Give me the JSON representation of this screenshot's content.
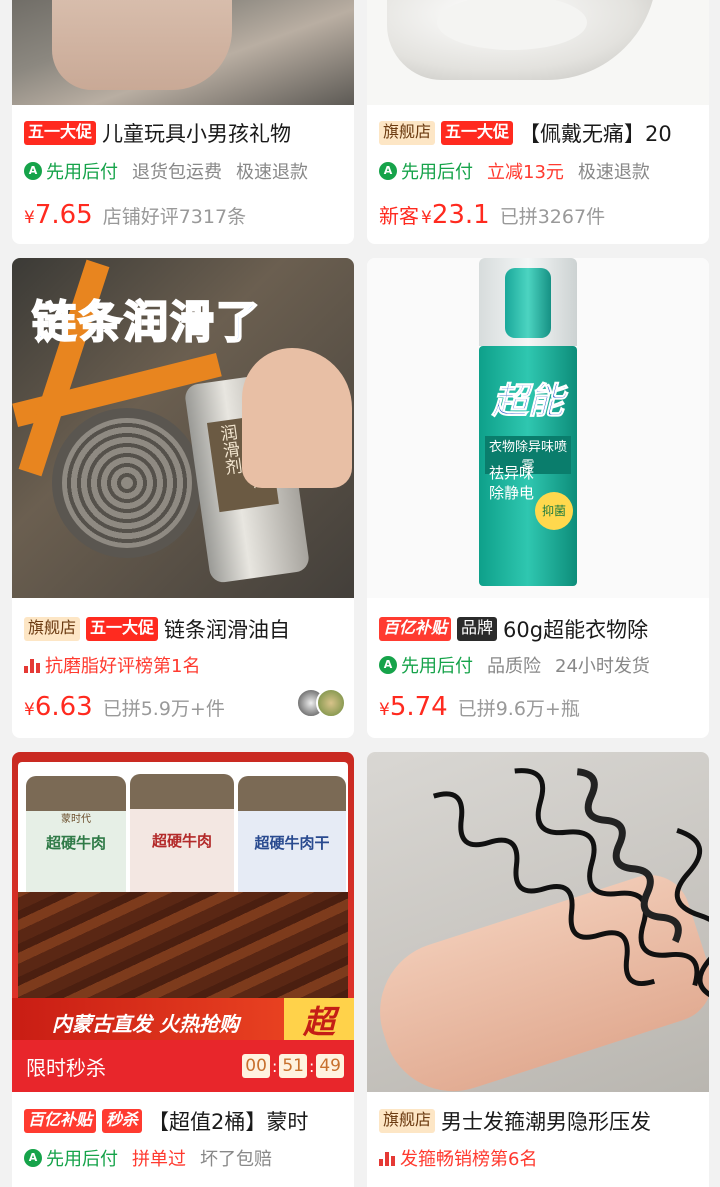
{
  "products": [
    {
      "tags": [
        "五一大促"
      ],
      "title": "儿童玩具小男孩礼物",
      "services": [
        "先用后付",
        "退货包运费",
        "极速退款"
      ],
      "price_currency": "¥",
      "price": "7.65",
      "sales": "店铺好评7317条"
    },
    {
      "tags": [
        "旗舰店",
        "五一大促"
      ],
      "title": "【佩戴无痛】20",
      "services": [
        "先用后付",
        "立减13元",
        "极速退款"
      ],
      "price_prefix": "新客",
      "price_currency": "¥",
      "price": "23.1",
      "sales": "已拼3267件"
    },
    {
      "image_text": "链条润滑了",
      "can_text": "链条专用润滑剂",
      "tags": [
        "旗舰店",
        "五一大促"
      ],
      "title": "链条润滑油自",
      "rank": "抗磨脂好评榜第1名",
      "price_currency": "¥",
      "price": "6.63",
      "sales": "已拼5.9万+件"
    },
    {
      "image_text": "超能",
      "bottle_label": "衣物除异味喷雾",
      "bottle_sub1": "祛异味",
      "bottle_sub2": "除静电",
      "bottle_badge": "抑菌",
      "tags": [
        "百亿补贴",
        "品牌"
      ],
      "title": "60g超能衣物除",
      "services": [
        "先用后付",
        "品质险",
        "24小时发货"
      ],
      "price_currency": "¥",
      "price": "5.74",
      "sales": "已拼9.6万+瓶"
    },
    {
      "jar_label": "超硬牛肉",
      "jar_label3": "超硬牛肉干",
      "jar_brand": "蒙时代",
      "banner_text": "内蒙古直发 火热抢购",
      "banner_badge": "超",
      "flash_label": "限时秒杀",
      "timer": [
        "00",
        "51",
        "49"
      ],
      "tags": [
        "百亿补贴",
        "秒杀"
      ],
      "title": "【超值2桶】蒙时",
      "services": [
        "先用后付",
        "拼单过",
        "坏了包赔"
      ]
    },
    {
      "tags": [
        "旗舰店"
      ],
      "title": "男士发箍潮男隐形压发",
      "rank": "发箍畅销榜第6名"
    }
  ],
  "colors": {
    "accent_red": "#ff2a1f",
    "service_green": "#16a34a",
    "background": "#f2f2f2"
  }
}
